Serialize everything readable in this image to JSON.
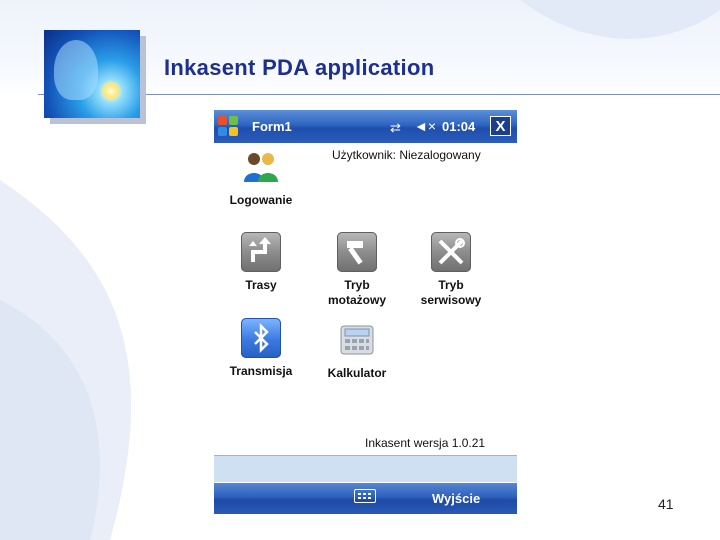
{
  "slide": {
    "title": "Inkasent PDA application",
    "page_number": "41"
  },
  "pda": {
    "titlebar": {
      "title": "Form1",
      "time": "01:04",
      "close_label": "X"
    },
    "user_status": "Użytkownik: Niezalogowany",
    "apps": [
      {
        "label": "Logowanie",
        "icon": "users-icon"
      },
      {
        "label": "Trasy",
        "icon": "route-icon"
      },
      {
        "label": "Tryb\nmotażowy",
        "icon": "hammer-icon"
      },
      {
        "label": "Tryb\nserwisowy",
        "icon": "tools-icon"
      },
      {
        "label": "Transmisja",
        "icon": "bluetooth-icon"
      },
      {
        "label": "Kalkulator",
        "icon": "calculator-icon"
      }
    ],
    "version": "Inkasent wersja 1.0.21",
    "softkeys": {
      "right": "Wyjście"
    }
  },
  "colors": {
    "title_blue": "#1d2f8f",
    "titlebar_blue": "#2f65c2"
  }
}
